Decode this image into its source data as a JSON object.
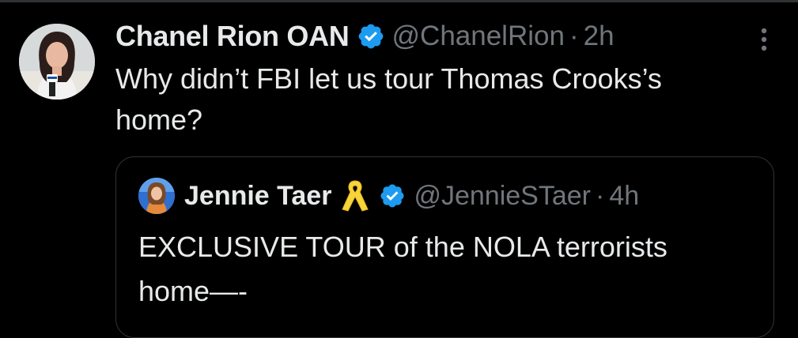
{
  "tweet": {
    "author": {
      "display_name": "Chanel Rion OAN",
      "handle": "@ChanelRion",
      "verified": true,
      "avatar_icon": "profile-photo"
    },
    "separator": "·",
    "time": "2h",
    "text": "Why didn’t FBI let us tour Thomas Crooks’s home?",
    "more_icon": "more-vertical-icon"
  },
  "quote": {
    "author": {
      "display_name": "Jennie Taer",
      "emoji": "yellow-ribbon",
      "handle": "@JennieSTaer",
      "verified": true,
      "avatar_icon": "profile-photo"
    },
    "separator": "·",
    "time": "4h",
    "text": "EXCLUSIVE TOUR of the NOLA terrorists home—-"
  },
  "colors": {
    "background": "#000000",
    "primary_text": "#e7e9ea",
    "secondary_text": "#71767b",
    "verified_badge": "#1d9bf0",
    "border": "#2f3336"
  }
}
